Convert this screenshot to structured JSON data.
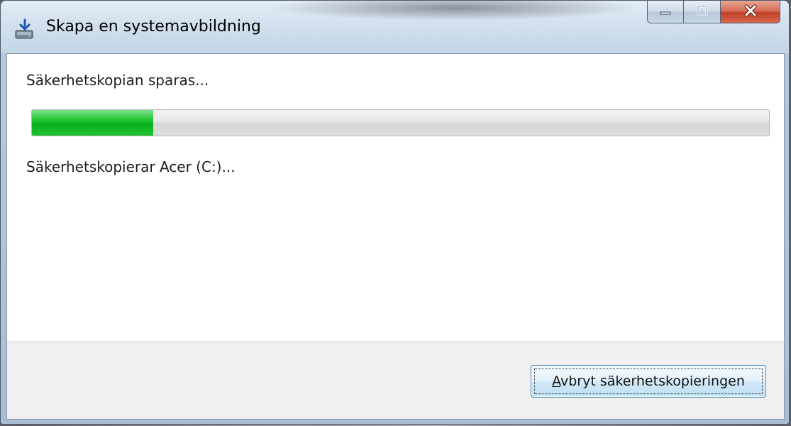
{
  "window": {
    "title": "Skapa en systemavbildning",
    "icon": "backup-drive-icon"
  },
  "caption_buttons": {
    "minimize_icon": "minimize-icon",
    "maximize_icon": "maximize-icon",
    "close_icon": "close-icon"
  },
  "content": {
    "heading": "Säkerhetskopian sparas...",
    "status": "Säkerhetskopierar Acer (C:)...",
    "progress": {
      "value_percent": 16.5,
      "color": "#06b01c"
    }
  },
  "footer": {
    "cancel_button": {
      "accelerator": "A",
      "label_rest": "vbryt säkerhetskopieringen"
    }
  },
  "colors": {
    "progress_fill": "#06b01c",
    "close_button": "#c2402a",
    "focus_border": "#3c7fb1"
  }
}
